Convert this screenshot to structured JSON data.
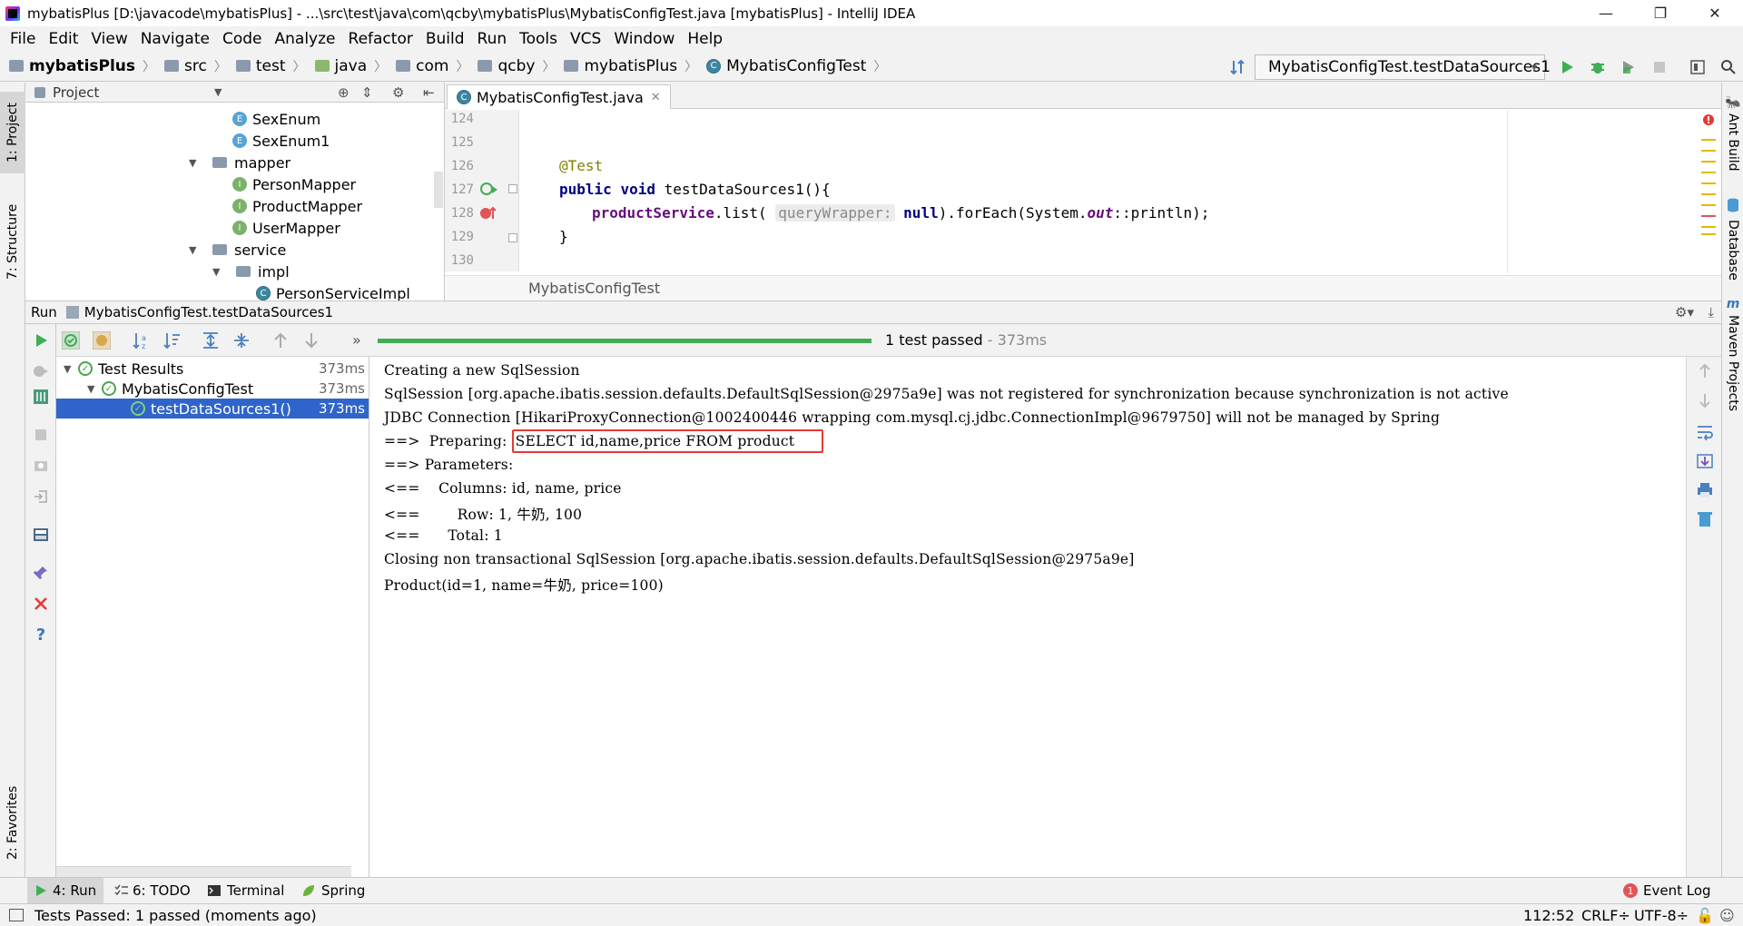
{
  "window": {
    "title": "mybatisPlus [D:\\javacode\\mybatisPlus] - ...\\src\\test\\java\\com\\qcby\\mybatisPlus\\MybatisConfigTest.java [mybatisPlus] - IntelliJ IDEA",
    "minimize": "—",
    "restore": "❐",
    "close": "✕"
  },
  "menu": [
    "File",
    "Edit",
    "View",
    "Navigate",
    "Code",
    "Analyze",
    "Refactor",
    "Build",
    "Run",
    "Tools",
    "VCS",
    "Window",
    "Help"
  ],
  "breadcrumbs": {
    "project": "mybatisPlus",
    "items": [
      "src",
      "test",
      "java",
      "com",
      "qcby",
      "mybatisPlus",
      "MybatisConfigTest"
    ]
  },
  "toolbar": {
    "run_config": "MybatisConfigTest.testDataSources1"
  },
  "left_strip": {
    "project": "1: Project",
    "structure": "7: Structure",
    "favorites": "2: Favorites"
  },
  "right_strip": {
    "ant": "Ant Build",
    "database": "Database",
    "maven": "Maven Projects"
  },
  "project_panel": {
    "title": "Project",
    "tree": [
      {
        "label": "SexEnum",
        "kind": "enum"
      },
      {
        "label": "SexEnum1",
        "kind": "enum"
      },
      {
        "label": "mapper",
        "kind": "folder"
      },
      {
        "label": "PersonMapper",
        "kind": "interface"
      },
      {
        "label": "ProductMapper",
        "kind": "interface"
      },
      {
        "label": "UserMapper",
        "kind": "interface"
      },
      {
        "label": "service",
        "kind": "folder"
      },
      {
        "label": "impl",
        "kind": "folder"
      },
      {
        "label": "PersonServiceImpl",
        "kind": "class"
      }
    ]
  },
  "editor": {
    "tab_label": "MybatisConfigTest.java",
    "lines": [
      "124",
      "125",
      "126",
      "127",
      "128",
      "129",
      "130"
    ],
    "code": {
      "annotation": "@Test",
      "kw_public": "public",
      "kw_void": "void",
      "method": "testDataSources1(){",
      "field": "productService",
      "call": ".list(",
      "hint": "queryWrapper:",
      "kw_null": "null",
      "rest1": ").forEach(System.",
      "out": "out",
      "rest2": "::println);",
      "close": "}"
    },
    "breadcrumb": "MybatisConfigTest"
  },
  "run_panel": {
    "label": "Run",
    "config": "MybatisConfigTest.testDataSources1",
    "progress": 1.0,
    "status": "1 test passed",
    "duration": " - 373ms",
    "tree": [
      {
        "label": "Test Results",
        "time": "373ms"
      },
      {
        "label": "MybatisConfigTest",
        "time": "373ms"
      },
      {
        "label": "testDataSources1()",
        "time": "373ms"
      }
    ],
    "console": [
      "Creating a new SqlSession",
      "SqlSession [org.apache.ibatis.session.defaults.DefaultSqlSession@2975a9e] was not registered for synchronization because synchronization is not active",
      "JDBC Connection [HikariProxyConnection@1002400446 wrapping com.mysql.cj.jdbc.ConnectionImpl@9679750] will not be managed by Spring",
      "==>  Preparing: ",
      "==> Parameters: ",
      "<==    Columns: id, name, price",
      "<==        Row: 1, 牛奶, 100",
      "<==      Total: 1",
      "Closing non transactional SqlSession [org.apache.ibatis.session.defaults.DefaultSqlSession@2975a9e]",
      "Product(id=1, name=牛奶, price=100)"
    ],
    "highlighted_sql": "SELECT id,name,price FROM product"
  },
  "bottom_tabs": {
    "run": "4: Run",
    "todo": "6: TODO",
    "terminal": "Terminal",
    "spring": "Spring",
    "event_log": "Event Log",
    "event_count": "1"
  },
  "status": {
    "message": "Tests Passed: 1 passed (moments ago)",
    "position": "112:52",
    "line_sep": "CRLF÷",
    "encoding": "UTF-8÷"
  },
  "colors": {
    "progress_green": "#3fae55",
    "highlight_box": "#e53935",
    "selection": "#2f65ca"
  }
}
